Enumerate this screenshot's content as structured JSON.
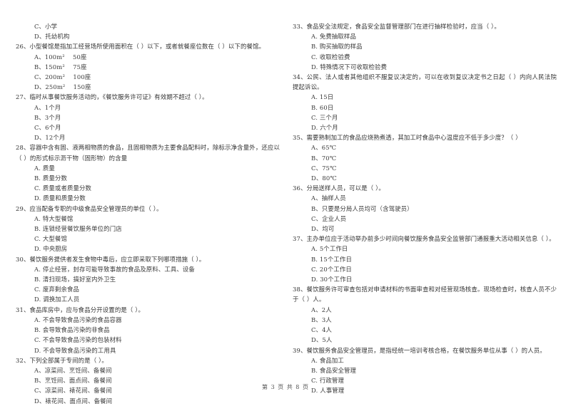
{
  "document": {
    "type": "exam-paper",
    "language": "zh-CN",
    "footer": "第 3 页 共 8 页"
  },
  "left_column": {
    "orphan_options": [
      "C、小学",
      "D、托幼机构"
    ],
    "questions": [
      {
        "number": "26",
        "stem": "26、小型餐馆是指加工经营场所使用面积在（        ）以下，或者就餐座位数在（        ）以下的餐馆。",
        "options": [
          "A、100m²    50座",
          "B、150m²    75座",
          "C、200m²    100座",
          "D、250m²    150座"
        ]
      },
      {
        "number": "27",
        "stem": "27、临时从事餐饮服务活动的，《餐饮服务许可证》有效期不超过（     ）。",
        "options": [
          "A、1个月",
          "B、3个月",
          "C、6个月",
          "D、12个月"
        ]
      },
      {
        "number": "28",
        "stem": "28、容器中含有固、液两相物质的食品，且固相物质为主要食品配料时，除标示净含量外，还应以（     ）的形式标示沥干物（固形物）的含量",
        "options": [
          "A. 质量",
          "B. 质量分数",
          "C. 质量或者质量分数",
          "D. 质量和质量分数"
        ]
      },
      {
        "number": "29",
        "stem": "29、应当配备专职的中级食品安全管理员的单位（     ）。",
        "options": [
          "A. 特大型餐馆",
          "B. 连锁经营餐饮服务单位的门店",
          "C. 大型餐馆",
          "D. 中央厨房"
        ]
      },
      {
        "number": "30",
        "stem": "30、餐饮服务提供者发生食物中毒后，应立即采取下列哪项措施（     ）。",
        "options": [
          "A. 停止经营，封存可能导致事故的食品及原料、工具、设备",
          "B. 清扫现场，搞好室内外卫生",
          "C. 废弃剩余食品",
          "D. 调换加工人员"
        ]
      },
      {
        "number": "31",
        "stem": "31、食品库房中，应与食品分开设置的是（     ）。",
        "options": [
          "A. 不会导致食品污染的食品容器",
          "B. 会导致食品污染的非食品",
          "C. 不会导致食品污染的包装材料",
          "D. 不会导致食品污染的工用具"
        ]
      },
      {
        "number": "32",
        "stem": "32、下列全部属于专间的是（     ）。",
        "options": [
          "A、凉菜间、烹饪间、备餐间",
          "B、烹饪间、面点间、备餐间",
          "C、凉菜间、裱花间、备餐间",
          "D、裱花间、面点间、备餐间"
        ]
      }
    ]
  },
  "right_column": {
    "questions": [
      {
        "number": "33",
        "stem": "33、食品安全法规定，食品安全监督管理部门在进行抽样检验时，应当（     ）。",
        "options": [
          "A. 免费抽取样品",
          "B. 购买抽取的样品",
          "C. 收取检验费",
          "D. 特殊情况下可收取检验费"
        ]
      },
      {
        "number": "34",
        "stem": "34、公民、法人或者其他组织不服复议决定的，可以在收到复议决定书之日起（     ）内向人民法院提起诉讼。",
        "options": [
          "A. 15日",
          "B. 60日",
          "C. 三个月",
          "D. 六个月"
        ]
      },
      {
        "number": "35",
        "stem": "35、需要熟制加工的食品应烧熟煮透，其加工时食品中心温度应不低于多少度？（     ）",
        "options": [
          "A、65℃",
          "B、70℃",
          "C、75℃",
          "D、80℃"
        ]
      },
      {
        "number": "36",
        "stem": "36、分局送样人员，可以是（     ）。",
        "options": [
          "A、抽样人员",
          "B、只要是分局人员均可（含驾驶员）",
          "C、企业人员",
          "D、均可"
        ]
      },
      {
        "number": "37",
        "stem": "37、主办单位应于活动举办前多少时间向餐饮服务食品安全监管部门通报重大活动相关信息（     ）。",
        "options": [
          "A. 5个工作日",
          "B. 15个工作日",
          "C. 20个工作日",
          "D. 30个工作日"
        ]
      },
      {
        "number": "38",
        "stem": "38、餐饮服务许可审查包括对申请材料的书面审查和对经营现场核查。现场检查时，核查人员不少于（     ）人。",
        "options": [
          "A、2人",
          "B、3人",
          "C、4人",
          "D、5人"
        ]
      },
      {
        "number": "39",
        "stem": "39、餐饮服务食品安全管理员，是指经统一培训考核合格，在餐饮服务单位从事（     ）的人员。",
        "options": [
          "A. 食品加工",
          "B. 食品安全管理",
          "C. 行政管理",
          "D. 人事管理"
        ]
      }
    ]
  }
}
